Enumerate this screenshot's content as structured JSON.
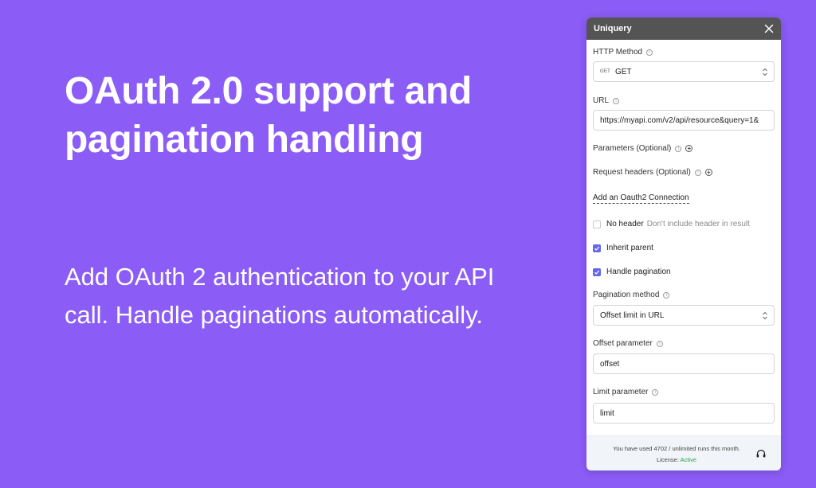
{
  "hero": {
    "title": "OAuth 2.0 support and pagination handling",
    "subtitle": "Add OAuth 2 authentication to your API call. Handle paginations automatically."
  },
  "panel": {
    "title": "Uniquery",
    "http_method": {
      "label": "HTTP Method",
      "tag": "GET",
      "value": "GET"
    },
    "url": {
      "label": "URL",
      "value": "https://myapi.com/v2/api/resource&query=1&"
    },
    "parameters_label": "Parameters (Optional)",
    "request_headers_label": "Request headers (Optional)",
    "oauth_link": "Add an Oauth2 Connection",
    "no_header": {
      "label": "No header",
      "hint": "Don't include header in result",
      "checked": false
    },
    "inherit_parent": {
      "label": "Inherit parent",
      "checked": true
    },
    "handle_pagination": {
      "label": "Handle pagination",
      "checked": true
    },
    "pagination_method": {
      "label": "Pagination method",
      "value": "Offset limit in URL"
    },
    "offset_parameter": {
      "label": "Offset parameter",
      "value": "offset"
    },
    "limit_parameter": {
      "label": "Limit parameter",
      "value": "limit"
    },
    "footer": {
      "usage": "You have used 4702 / unlimited runs this month.",
      "license_label": "License:",
      "license_status": "Active"
    }
  },
  "colors": {
    "background": "#8b5cf6",
    "header": "#545454",
    "checkbox_accent": "#6366f1",
    "license_active": "#22a34a"
  }
}
